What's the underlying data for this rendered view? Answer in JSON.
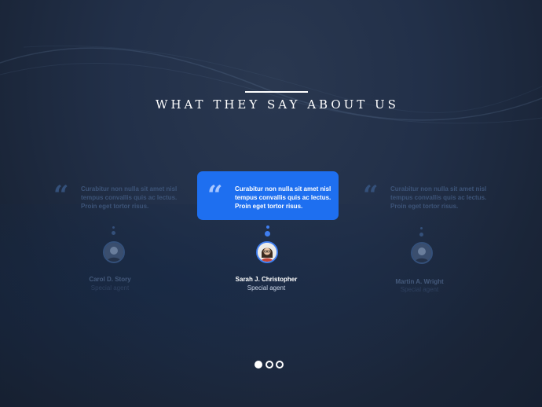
{
  "section": {
    "title": "WHAT THEY SAY ABOUT US"
  },
  "testimonials": [
    {
      "quote_icon": "quote-icon",
      "text": "Curabitur non nulla sit amet nisl tempus convallis quis ac lectus. Proin eget tortor risus.",
      "name": "Carol D. Story",
      "role": "Special agent",
      "active": false
    },
    {
      "quote_icon": "quote-icon",
      "text": "Curabitur non nulla sit amet nisl tempus convallis quis ac lectus. Proin eget tortor risus.",
      "name": "Sarah J. Christopher",
      "role": "Special agent",
      "active": true
    },
    {
      "quote_icon": "quote-icon",
      "text": "Curabitur non nulla sit amet nisl tempus convallis quis ac lectus. Proin eget tortor risus.",
      "name": "Martin A. Wright",
      "role": "Special agent",
      "active": false
    }
  ],
  "pagination": {
    "pages": 3,
    "current": 1
  },
  "colors": {
    "accent": "#1e6ff0",
    "background": "#1f2c42",
    "dim_text": "#3d5478"
  }
}
